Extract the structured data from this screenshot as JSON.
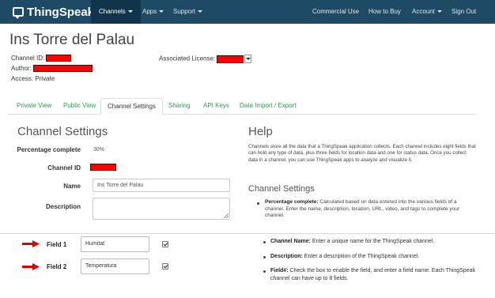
{
  "navbar": {
    "brand": "ThingSpeak",
    "trademark": "™",
    "left_items": [
      "Channels",
      "Apps",
      "Support"
    ],
    "right_items": [
      "Commercial Use",
      "How to Buy",
      "Account",
      "Sign Out"
    ]
  },
  "header": {
    "title": "Ins Torre del Palau",
    "channel_id_label": "Channel ID:",
    "author_label": "Author:",
    "access_label": "Access:",
    "access_value": "Private",
    "license_label": "Associated License:"
  },
  "tabs": [
    "Private View",
    "Public View",
    "Channel Settings",
    "Sharing",
    "API Keys",
    "Data Import / Export"
  ],
  "settings": {
    "title": "Channel Settings",
    "percentage_label": "Percentage complete",
    "percentage_value": "30%",
    "channel_id_label": "Channel ID",
    "name_label": "Name",
    "name_value": "Ins Torre del Palau",
    "description_label": "Description"
  },
  "help": {
    "title": "Help",
    "paragraph": "Channels store all the data that a ThingSpeak application collects. Each channel includes eight fields that can hold any type of data, plus three fields for location data and one for status data. Once you collect data in a channel, you can use ThingSpeak apps to analyze and visualize it.",
    "subtitle": "Channel Settings",
    "bullet1_term": "Percentage complete:",
    "bullet1_text": "Calculated based on data entered into the various fields of a channel. Enter the name, description, location, URL, video, and tags to complete your channel."
  },
  "fields": [
    {
      "label": "Field 1",
      "value": "Humitat",
      "checked": true
    },
    {
      "label": "Field 2",
      "value": "Temperatura",
      "checked": true
    }
  ],
  "lower_help": [
    {
      "term": "Channel Name:",
      "text": "Enter a unique name for the ThingSpeak channel."
    },
    {
      "term": "Description:",
      "text": "Enter a description of the ThingSpeak channel."
    },
    {
      "term": "Field#:",
      "text": "Check the box to enable the field, and enter a field name. Each ThingSpeak channel can have up to 8 fields."
    }
  ],
  "colors": {
    "navbar": "#1e4a66",
    "navbar_active": "#0f344b",
    "tab_link": "#2e9a4e",
    "redaction": "#ff0000",
    "arrow": "#e00000"
  }
}
